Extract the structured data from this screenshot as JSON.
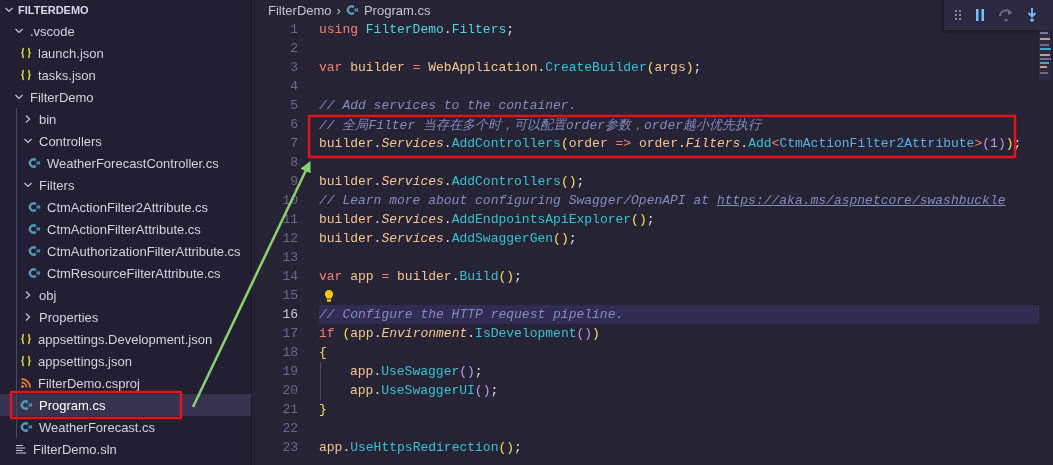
{
  "explorer": {
    "title": "FILTERDEMO",
    "expanded": true,
    "items": [
      {
        "label": ".vscode",
        "kind": "folder",
        "expanded": true,
        "selected": false,
        "children": [
          {
            "label": "launch.json",
            "kind": "json",
            "selected": false
          },
          {
            "label": "tasks.json",
            "kind": "json",
            "selected": false
          }
        ]
      },
      {
        "label": "FilterDemo",
        "kind": "folder",
        "expanded": true,
        "selected": false,
        "children": [
          {
            "label": "bin",
            "kind": "folder",
            "expanded": false,
            "selected": false
          },
          {
            "label": "Controllers",
            "kind": "folder",
            "expanded": true,
            "selected": false,
            "children": [
              {
                "label": "WeatherForecastController.cs",
                "kind": "csharp",
                "selected": false
              }
            ]
          },
          {
            "label": "Filters",
            "kind": "folder",
            "expanded": true,
            "selected": false,
            "children": [
              {
                "label": "CtmActionFilter2Attribute.cs",
                "kind": "csharp",
                "selected": false
              },
              {
                "label": "CtmActionFilterAttribute.cs",
                "kind": "csharp",
                "selected": false
              },
              {
                "label": "CtmAuthorizationFilterAttribute.cs",
                "kind": "csharp",
                "selected": false
              },
              {
                "label": "CtmResourceFilterAttribute.cs",
                "kind": "csharp",
                "selected": false
              }
            ]
          },
          {
            "label": "obj",
            "kind": "folder",
            "expanded": false,
            "selected": false
          },
          {
            "label": "Properties",
            "kind": "folder",
            "expanded": false,
            "selected": false
          },
          {
            "label": "appsettings.Development.json",
            "kind": "json",
            "selected": false
          },
          {
            "label": "appsettings.json",
            "kind": "json",
            "selected": false
          },
          {
            "label": "FilterDemo.csproj",
            "kind": "project",
            "selected": false
          },
          {
            "label": "Program.cs",
            "kind": "csharp",
            "selected": true
          },
          {
            "label": "WeatherForecast.cs",
            "kind": "csharp",
            "selected": false
          }
        ]
      },
      {
        "label": "FilterDemo.sln",
        "kind": "solution",
        "selected": false
      }
    ]
  },
  "breadcrumb": {
    "folder": "FilterDemo",
    "separator": "›",
    "file": "Program.cs"
  },
  "editor": {
    "lines": [
      {
        "number": "1",
        "tokens": [
          {
            "text": "using ",
            "kind": "keyword"
          },
          {
            "text": "FilterDemo",
            "kind": "namespace"
          },
          {
            "text": ".",
            "kind": "punct"
          },
          {
            "text": "Filters",
            "kind": "namespace"
          },
          {
            "text": ";",
            "kind": "punct"
          }
        ]
      },
      {
        "number": "2"
      },
      {
        "number": "3",
        "tokens": [
          {
            "text": "var",
            "kind": "keyword"
          },
          {
            "text": " builder ",
            "kind": "var"
          },
          {
            "text": "=",
            "kind": "op"
          },
          {
            "text": " WebApplication",
            "kind": "var"
          },
          {
            "text": ".",
            "kind": "punct"
          },
          {
            "text": "CreateBuilder",
            "kind": "method"
          },
          {
            "text": "(",
            "kind": "paren"
          },
          {
            "text": "args",
            "kind": "var"
          },
          {
            "text": ")",
            "kind": "paren"
          },
          {
            "text": ";",
            "kind": "punct"
          }
        ]
      },
      {
        "number": "4"
      },
      {
        "number": "5",
        "tokens": [
          {
            "text": "// Add services to the container.",
            "kind": "comment"
          }
        ]
      },
      {
        "number": "6",
        "tokens": [
          {
            "text": "// 全局Filter 当存在多个时，可以配置order参数，order越小优先执行",
            "kind": "comment"
          }
        ]
      },
      {
        "number": "7",
        "tokens": [
          {
            "text": "builder",
            "kind": "var"
          },
          {
            "text": ".",
            "kind": "punct"
          },
          {
            "text": "Services",
            "kind": "prop"
          },
          {
            "text": ".",
            "kind": "punct"
          },
          {
            "text": "AddControllers",
            "kind": "method"
          },
          {
            "text": "(",
            "kind": "paren"
          },
          {
            "text": "order",
            "kind": "var"
          },
          {
            "text": " => ",
            "kind": "op"
          },
          {
            "text": "order",
            "kind": "var"
          },
          {
            "text": ".",
            "kind": "punct"
          },
          {
            "text": "Filters",
            "kind": "prop"
          },
          {
            "text": ".",
            "kind": "punct"
          },
          {
            "text": "Add",
            "kind": "method"
          },
          {
            "text": "<",
            "kind": "op"
          },
          {
            "text": "CtmActionFilter2Attribute",
            "kind": "type"
          },
          {
            "text": ">",
            "kind": "op"
          },
          {
            "text": "(",
            "kind": "paren2"
          },
          {
            "text": "1",
            "kind": "number"
          },
          {
            "text": ")",
            "kind": "paren2"
          },
          {
            "text": ")",
            "kind": "paren"
          },
          {
            "text": ";",
            "kind": "punct"
          }
        ]
      },
      {
        "number": "8"
      },
      {
        "number": "9",
        "tokens": [
          {
            "text": "builder",
            "kind": "var"
          },
          {
            "text": ".",
            "kind": "punct"
          },
          {
            "text": "Services",
            "kind": "prop"
          },
          {
            "text": ".",
            "kind": "punct"
          },
          {
            "text": "AddControllers",
            "kind": "method"
          },
          {
            "text": "()",
            "kind": "paren"
          },
          {
            "text": ";",
            "kind": "punct"
          }
        ]
      },
      {
        "number": "10",
        "tokens": [
          {
            "text": "// Learn more about configuring Swagger/OpenAPI at ",
            "kind": "comment"
          },
          {
            "text": "https://aka.ms/aspnetcore/swashbuckle",
            "kind": "link"
          }
        ]
      },
      {
        "number": "11",
        "tokens": [
          {
            "text": "builder",
            "kind": "var"
          },
          {
            "text": ".",
            "kind": "punct"
          },
          {
            "text": "Services",
            "kind": "prop"
          },
          {
            "text": ".",
            "kind": "punct"
          },
          {
            "text": "AddEndpointsApiExplorer",
            "kind": "method"
          },
          {
            "text": "()",
            "kind": "paren"
          },
          {
            "text": ";",
            "kind": "punct"
          }
        ]
      },
      {
        "number": "12",
        "tokens": [
          {
            "text": "builder",
            "kind": "var"
          },
          {
            "text": ".",
            "kind": "punct"
          },
          {
            "text": "Services",
            "kind": "prop"
          },
          {
            "text": ".",
            "kind": "punct"
          },
          {
            "text": "AddSwaggerGen",
            "kind": "method"
          },
          {
            "text": "()",
            "kind": "paren"
          },
          {
            "text": ";",
            "kind": "punct"
          }
        ]
      },
      {
        "number": "13"
      },
      {
        "number": "14",
        "tokens": [
          {
            "text": "var",
            "kind": "keyword"
          },
          {
            "text": " app ",
            "kind": "var"
          },
          {
            "text": "=",
            "kind": "op"
          },
          {
            "text": " builder",
            "kind": "var"
          },
          {
            "text": ".",
            "kind": "punct"
          },
          {
            "text": "Build",
            "kind": "method"
          },
          {
            "text": "()",
            "kind": "paren"
          },
          {
            "text": ";",
            "kind": "punct"
          }
        ]
      },
      {
        "number": "15",
        "lightbulb": true
      },
      {
        "number": "16",
        "tokens": [
          {
            "text": "// Configure the HTTP request pipeline.",
            "kind": "comment"
          }
        ],
        "current": true
      },
      {
        "number": "17",
        "tokens": [
          {
            "text": "if ",
            "kind": "keyword"
          },
          {
            "text": "(",
            "kind": "paren"
          },
          {
            "text": "app",
            "kind": "var"
          },
          {
            "text": ".",
            "kind": "punct"
          },
          {
            "text": "Environment",
            "kind": "prop"
          },
          {
            "text": ".",
            "kind": "punct"
          },
          {
            "text": "IsDevelopment",
            "kind": "method"
          },
          {
            "text": "()",
            "kind": "paren2"
          },
          {
            "text": ")",
            "kind": "paren"
          }
        ]
      },
      {
        "number": "18",
        "tokens": [
          {
            "text": "{",
            "kind": "paren"
          }
        ]
      },
      {
        "number": "19",
        "indented": true,
        "tokens": [
          {
            "text": "app",
            "kind": "var"
          },
          {
            "text": ".",
            "kind": "punct"
          },
          {
            "text": "UseSwagger",
            "kind": "method"
          },
          {
            "text": "()",
            "kind": "paren2"
          },
          {
            "text": ";",
            "kind": "punct"
          }
        ]
      },
      {
        "number": "20",
        "indented": true,
        "tokens": [
          {
            "text": "app",
            "kind": "var"
          },
          {
            "text": ".",
            "kind": "punct"
          },
          {
            "text": "UseSwaggerUI",
            "kind": "method"
          },
          {
            "text": "()",
            "kind": "paren2"
          },
          {
            "text": ";",
            "kind": "punct"
          }
        ]
      },
      {
        "number": "21",
        "tokens": [
          {
            "text": "}",
            "kind": "paren"
          }
        ]
      },
      {
        "number": "22"
      },
      {
        "number": "23",
        "tokens": [
          {
            "text": "app",
            "kind": "var"
          },
          {
            "text": ".",
            "kind": "punct"
          },
          {
            "text": "UseHttpsRedirection",
            "kind": "method"
          },
          {
            "text": "()",
            "kind": "paren"
          },
          {
            "text": ";",
            "kind": "punct"
          }
        ]
      }
    ]
  }
}
